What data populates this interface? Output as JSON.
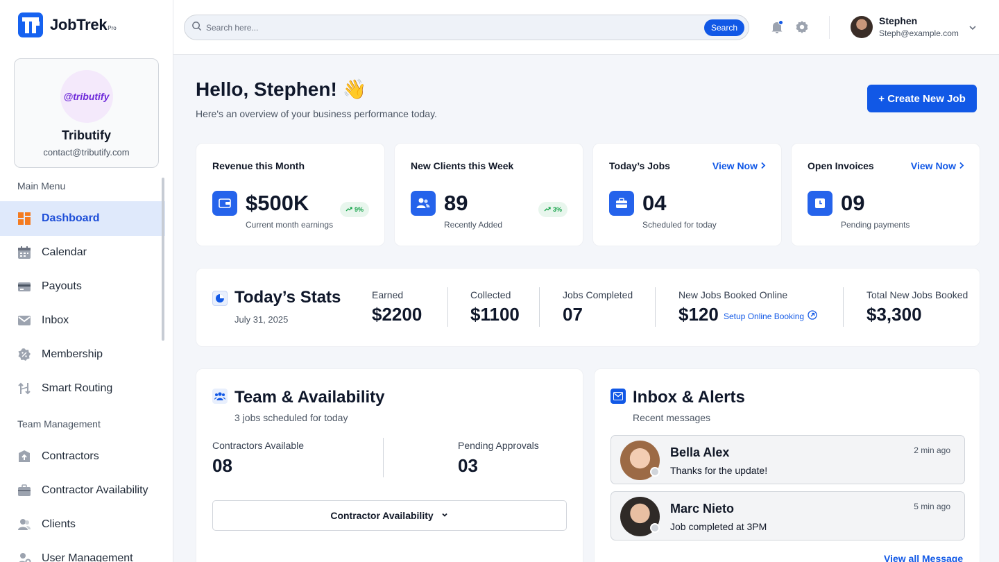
{
  "brand": {
    "name": "JobTrek",
    "suffix": "Pro",
    "accent": "#1158e6"
  },
  "company": {
    "logo_text": "@tributify",
    "name": "Tributify",
    "email": "contact@tributify.com"
  },
  "sidebar": {
    "main_menu_label": "Main Menu",
    "main_items": [
      {
        "label": "Dashboard",
        "icon": "dashboard-grid-icon",
        "active": true
      },
      {
        "label": "Calendar",
        "icon": "calendar-icon"
      },
      {
        "label": "Payouts",
        "icon": "credit-card-icon"
      },
      {
        "label": "Inbox",
        "icon": "envelope-icon"
      },
      {
        "label": "Membership",
        "icon": "badge-percent-icon"
      },
      {
        "label": "Smart Routing",
        "icon": "routing-arrows-icon"
      }
    ],
    "team_label": "Team Management",
    "team_items": [
      {
        "label": "Contractors",
        "icon": "contractor-upload-icon"
      },
      {
        "label": "Contractor Availability",
        "icon": "briefcase-icon"
      },
      {
        "label": "Clients",
        "icon": "users-icon"
      },
      {
        "label": "User Management",
        "icon": "user-settings-icon"
      }
    ]
  },
  "topbar": {
    "search_placeholder": "Search here...",
    "search_button": "Search",
    "user_name": "Stephen",
    "user_email": "Steph@example.com"
  },
  "header": {
    "greeting": "Hello, Stephen! 👋",
    "subtitle": "Here's an overview of your business performance today.",
    "create_button": "+ Create New Job"
  },
  "kpis": [
    {
      "title": "Revenue this Month",
      "value": "$500K",
      "sub": "Current month earnings",
      "badge": "9%",
      "icon": "wallet-icon"
    },
    {
      "title": "New Clients this Week",
      "value": "89",
      "sub": "Recently Added",
      "badge": "3%",
      "icon": "users-icon"
    },
    {
      "title": "Today’s Jobs",
      "value": "04",
      "sub": "Scheduled for today",
      "link": "View Now",
      "icon": "briefcase-icon"
    },
    {
      "title": "Open Invoices",
      "value": "09",
      "sub": "Pending payments",
      "link": "View Now",
      "icon": "clock-icon"
    }
  ],
  "today_stats": {
    "title": "Today’s Stats",
    "date": "July 31, 2025",
    "earned_label": "Earned",
    "earned_value": "$2200",
    "collected_label": "Collected",
    "collected_value": "$1100",
    "jobs_completed_label": "Jobs Completed",
    "jobs_completed_value": "07",
    "online_label": "New Jobs Booked Online",
    "online_value": "$120",
    "booking_link": "Setup Online Booking",
    "total_label": "Total New Jobs Booked",
    "total_value": "$3,300"
  },
  "team": {
    "title": "Team & Availability",
    "subtitle": "3 jobs scheduled for today",
    "available_label": "Contractors Available",
    "available_value": "08",
    "pending_label": "Pending Approvals",
    "pending_value": "03",
    "dropdown_label": "Contractor Availability"
  },
  "inbox": {
    "title": "Inbox & Alerts",
    "subtitle": "Recent messages",
    "messages": [
      {
        "name": "Bella Alex",
        "text": "Thanks for the update!",
        "time": "2 min ago"
      },
      {
        "name": "Marc Nieto",
        "text": "Job completed at 3PM",
        "time": "5 min ago"
      }
    ],
    "view_all": "View all Message"
  }
}
